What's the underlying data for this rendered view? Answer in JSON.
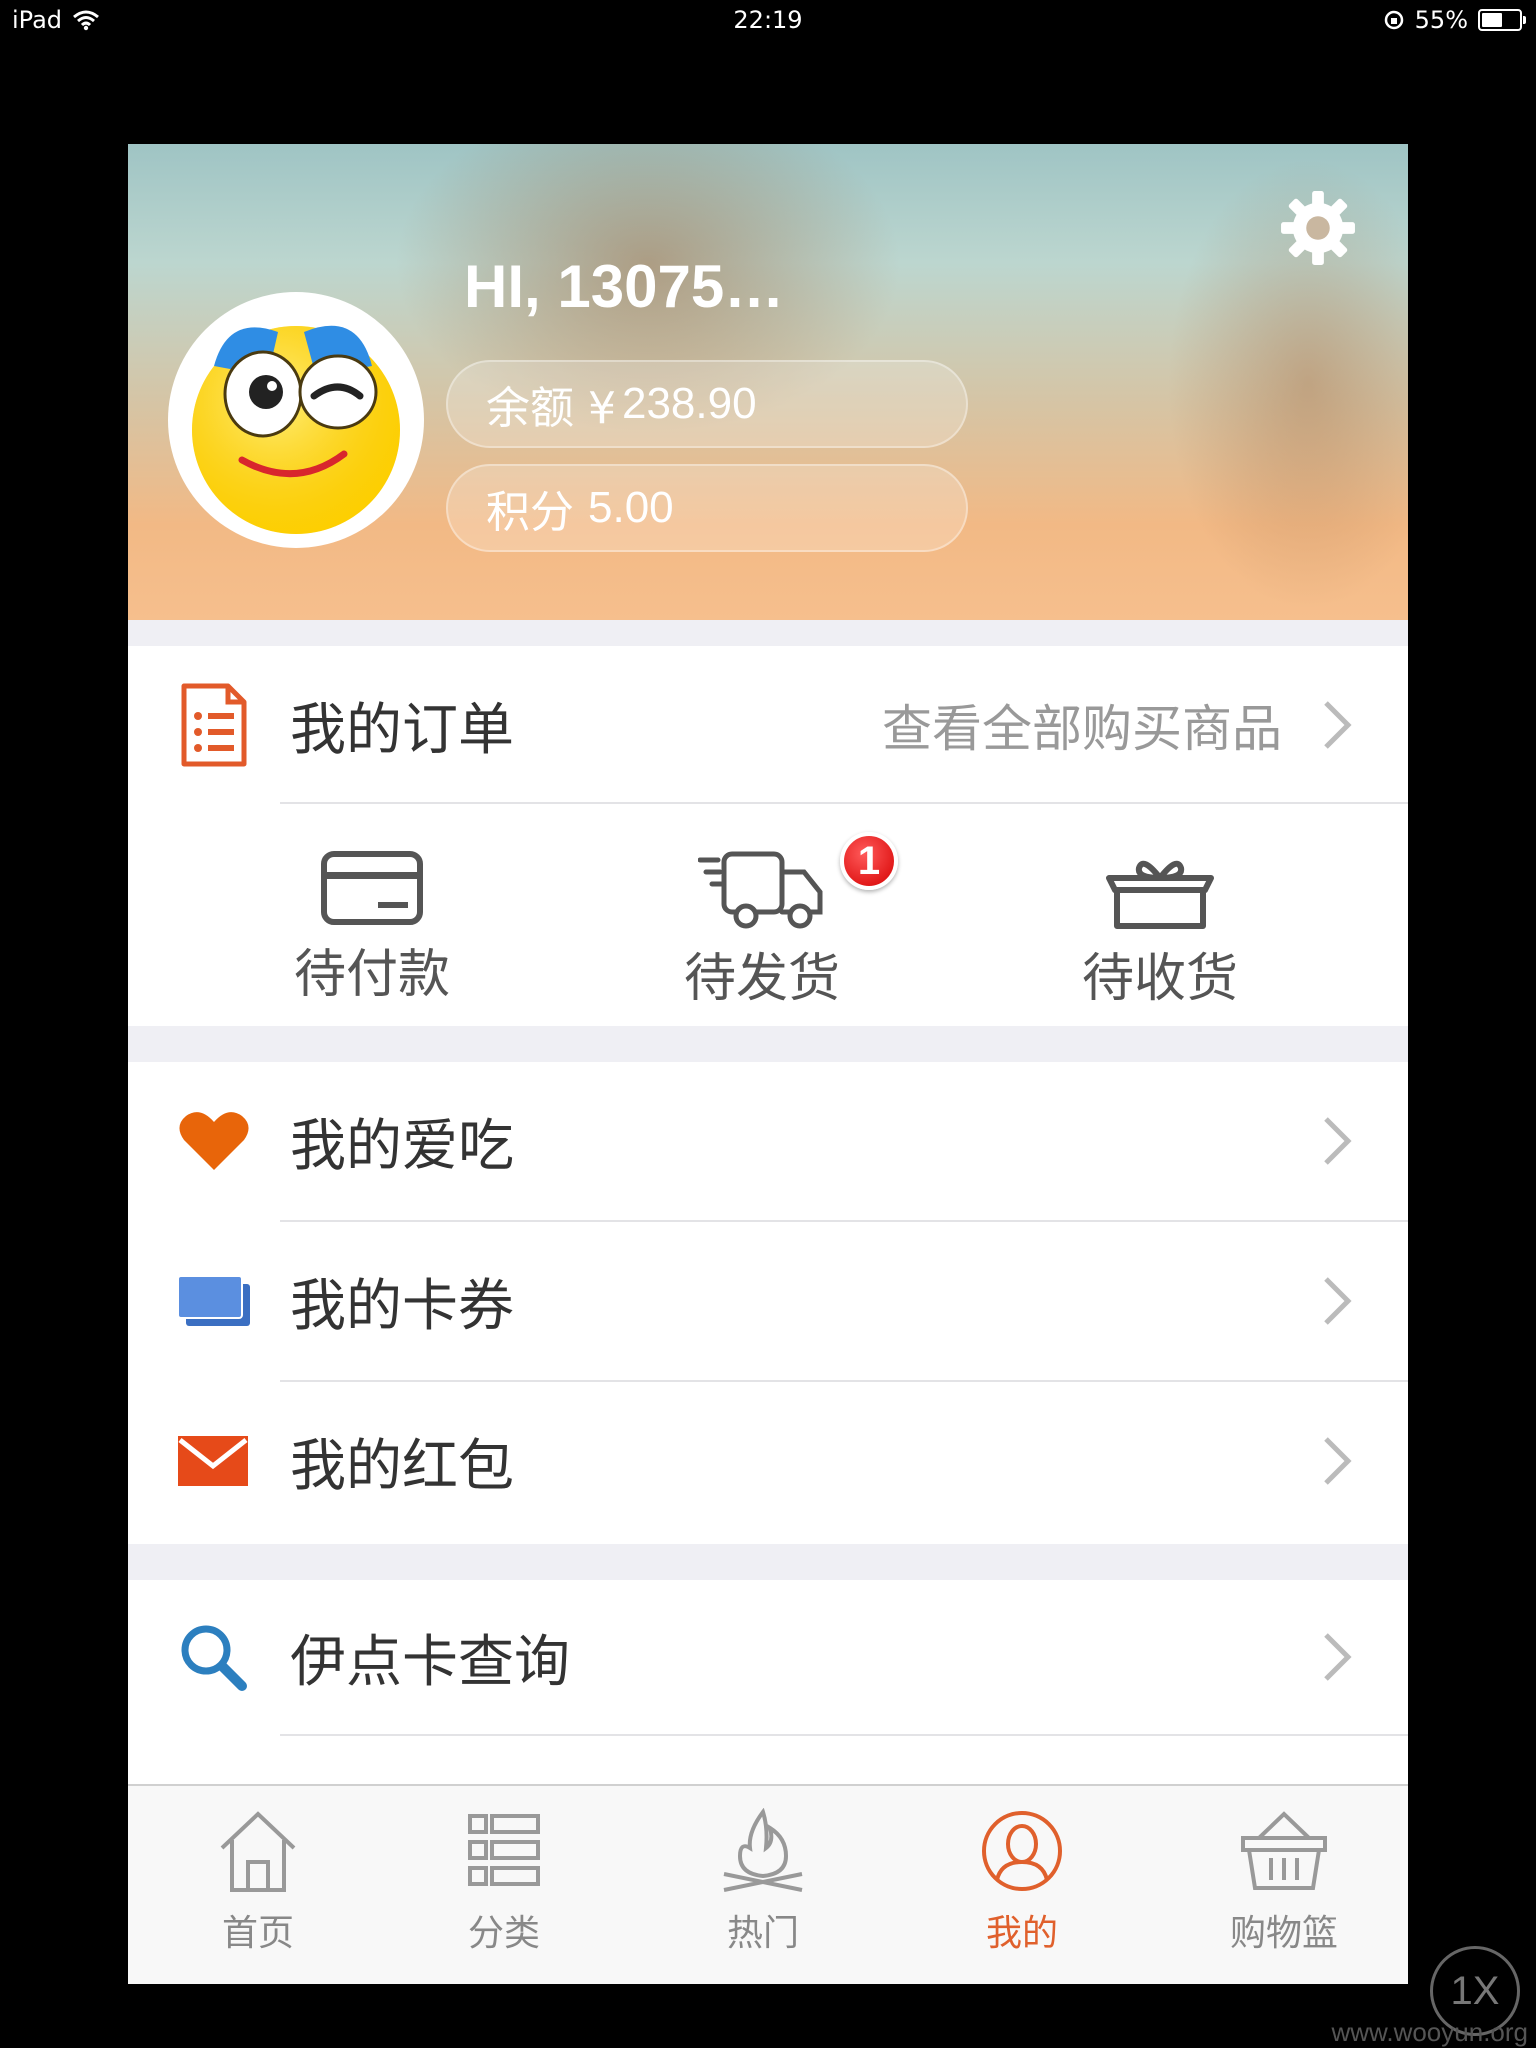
{
  "status_bar": {
    "device": "iPad",
    "time": "22:19",
    "battery": "55%",
    "battery_level": 0.55
  },
  "profile": {
    "greeting": "HI, 13075…",
    "balance_label": "余额 ¥",
    "balance_value": "238.90",
    "points_label": "积分",
    "points_value": "5.00"
  },
  "orders": {
    "title": "我的订单",
    "view_all": "查看全部购买商品",
    "statuses": [
      {
        "label": "待付款"
      },
      {
        "label": "待发货",
        "badge": "1"
      },
      {
        "label": "待收货"
      }
    ]
  },
  "menu_group_1": [
    {
      "label": "我的爱吃",
      "icon": "heart-icon",
      "color": "#e8650a"
    },
    {
      "label": "我的卡券",
      "icon": "cards-icon",
      "color": "#4a7fd4"
    },
    {
      "label": "我的红包",
      "icon": "envelope-icon",
      "color": "#e64a19"
    }
  ],
  "menu_group_2": [
    {
      "label": "伊点卡查询",
      "icon": "search-icon",
      "color": "#2c7fbf"
    }
  ],
  "tabbar": {
    "items": [
      {
        "label": "首页",
        "icon": "home-icon"
      },
      {
        "label": "分类",
        "icon": "category-icon"
      },
      {
        "label": "热门",
        "icon": "fire-icon"
      },
      {
        "label": "我的",
        "icon": "user-icon",
        "active": true
      },
      {
        "label": "购物篮",
        "icon": "basket-icon"
      }
    ],
    "active_color": "#e0602c"
  },
  "overlay": {
    "zoom": "1X",
    "watermark": "www.wooyun.org"
  }
}
